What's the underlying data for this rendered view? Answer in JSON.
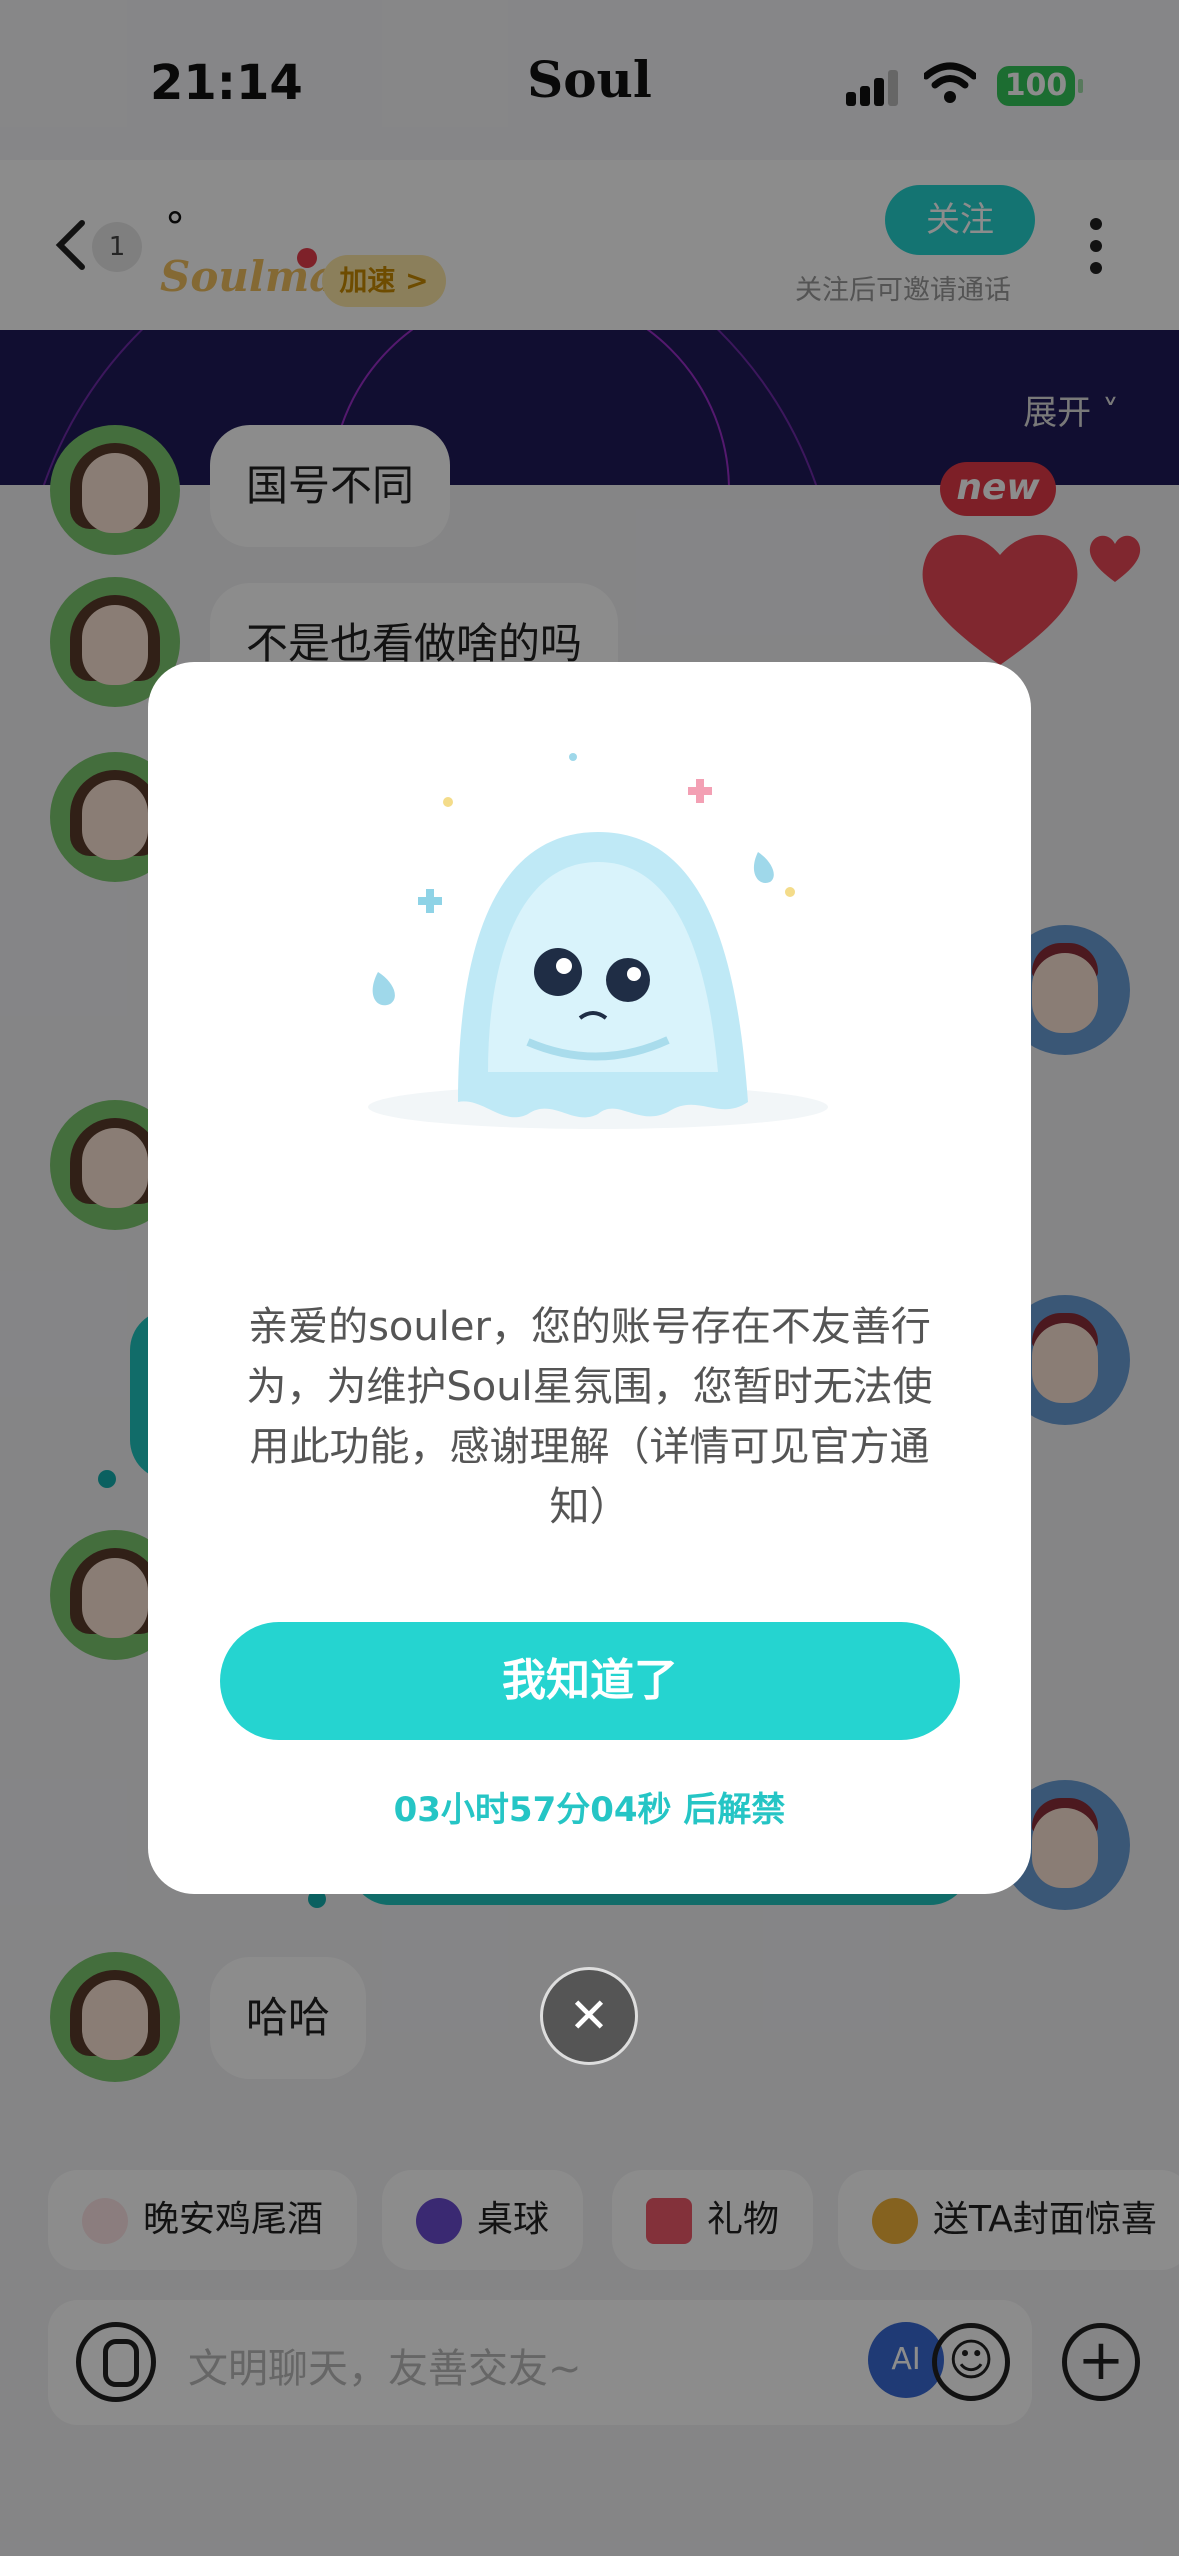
{
  "status_bar": {
    "time": "21:14",
    "carrier": "Soul",
    "battery": "100"
  },
  "header": {
    "back_count": "1",
    "nickname": "°",
    "soulmate_label": "Soulmate",
    "speed_label": "加速 >",
    "follow_label": "关注",
    "follow_hint": "关注后可邀请通话"
  },
  "banner": {
    "expand_label": "展开 ˅"
  },
  "chat": {
    "partial_message": "国号不同",
    "messages": [
      {
        "side": "left",
        "text": "不是也看做啥的吗"
      },
      {
        "side": "left",
        "text": "哈哈"
      }
    ],
    "new_badge": "new"
  },
  "shortcuts": [
    {
      "label": "晚安鸡尾酒",
      "icon": "cocktail-icon",
      "color": "#e84b5a"
    },
    {
      "label": "桌球",
      "icon": "billiard-ball-icon",
      "color": "#6a4bd0"
    },
    {
      "label": "礼物",
      "icon": "gift-icon",
      "color": "#e84b5a"
    },
    {
      "label": "送TA封面惊喜",
      "icon": "heart-chat-icon",
      "color": "#f0a030"
    }
  ],
  "input": {
    "placeholder": "文明聊天，友善交友~",
    "ai_label": "AI"
  },
  "modal": {
    "message": "亲爱的souler，您的账号存在不友善行为，为维护Soul星氛围，您暂时无法使用此功能，感谢理解（详情可见官方通知）",
    "ok_label": "我知道了",
    "countdown": "03小时57分04秒 后解禁",
    "close_label": "✕"
  },
  "colors": {
    "accent": "#25d4d0",
    "danger": "#e33a48"
  }
}
